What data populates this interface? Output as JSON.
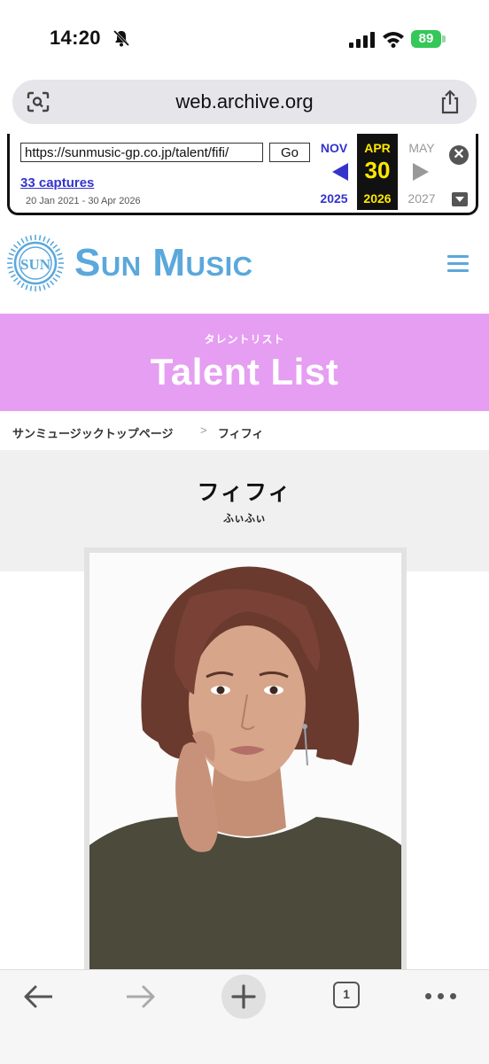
{
  "status_bar": {
    "time": "14:20",
    "battery": "89"
  },
  "browser": {
    "url": "web.archive.org",
    "icons": [
      "page-scan-icon",
      "share-icon"
    ]
  },
  "wayback": {
    "archived_url": "https://sunmusic-gp.co.jp/talent/fifi/",
    "go_label": "Go",
    "captures": "33 captures",
    "range": "20 Jan 2021 - 30 Apr 2026",
    "prev": {
      "month": "NOV",
      "year": "2025"
    },
    "current": {
      "month": "APR",
      "day": "30",
      "year": "2026"
    },
    "next": {
      "month": "MAY",
      "year": "2027"
    },
    "close_symbol": "✕"
  },
  "site": {
    "logo_text": "Sun Music",
    "brand_color": "#5aa8dc"
  },
  "banner": {
    "subtitle": "タレントリスト",
    "title": "Talent List",
    "color": "#e59ef2"
  },
  "breadcrumb": {
    "home": "サンミュージックトップページ",
    "separator": ">",
    "current": "フィフィ"
  },
  "profile": {
    "name": "フィフィ",
    "kana": "ふぃふぃ"
  },
  "bottom_bar": {
    "tab_count": "1",
    "icons": [
      "back-arrow-icon",
      "forward-arrow-icon",
      "plus-icon",
      "tabs-icon",
      "more-icon"
    ]
  }
}
